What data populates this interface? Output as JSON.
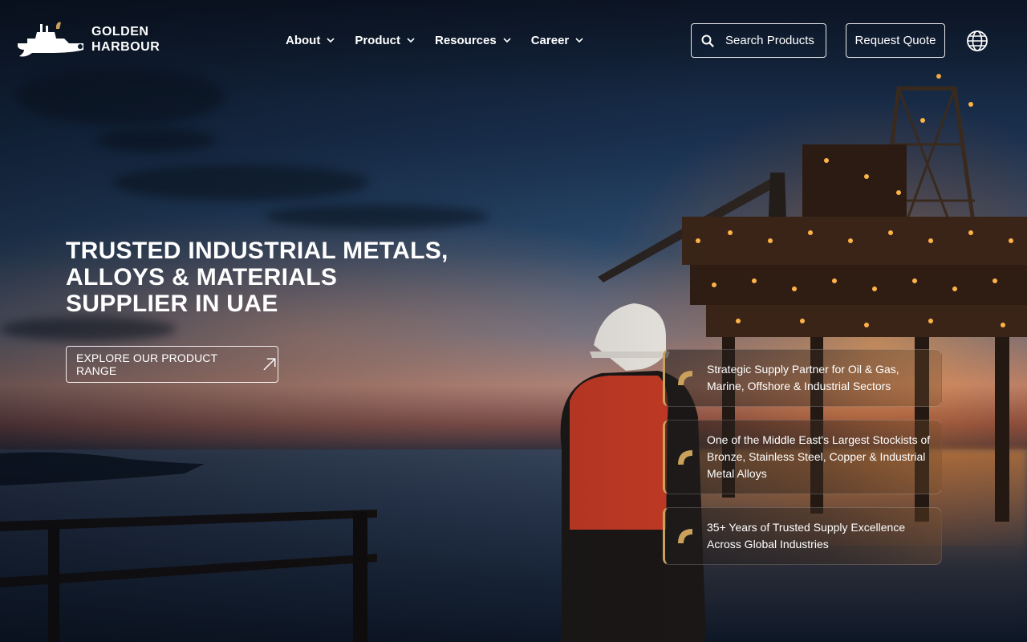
{
  "brand": {
    "name_line1": "GOLDEN",
    "name_line2": "HARBOUR",
    "logo_icon": "ship-wrench-logo",
    "accent_color": "#c9a15a"
  },
  "nav": {
    "items": [
      {
        "label": "About",
        "icon": "chevron-down-icon"
      },
      {
        "label": "Product",
        "icon": "chevron-down-icon"
      },
      {
        "label": "Resources",
        "icon": "chevron-down-icon"
      },
      {
        "label": "Career",
        "icon": "chevron-down-icon"
      }
    ]
  },
  "header": {
    "search_label": "Search Products",
    "search_icon": "search-icon",
    "quote_label": "Request Quote",
    "language_icon": "globe-icon"
  },
  "hero": {
    "title_lines": [
      "TRUSTED INDUSTRIAL METALS,",
      "ALLOYS & MATERIALS",
      "SUPPLIER IN UAE"
    ],
    "cta_label": "EXPLORE OUR PRODUCT RANGE",
    "cta_icon": "arrow-up-right-icon"
  },
  "features": [
    {
      "text": "Strategic Supply Partner for Oil & Gas, Marine, Offshore & Industrial Sectors"
    },
    {
      "text": "One of the Middle East's Largest Stockists of Bronze, Stainless Steel, Copper & Industrial Metal Alloys"
    },
    {
      "text": "35+ Years of Trusted Supply Excellence Across Global Industries"
    }
  ]
}
